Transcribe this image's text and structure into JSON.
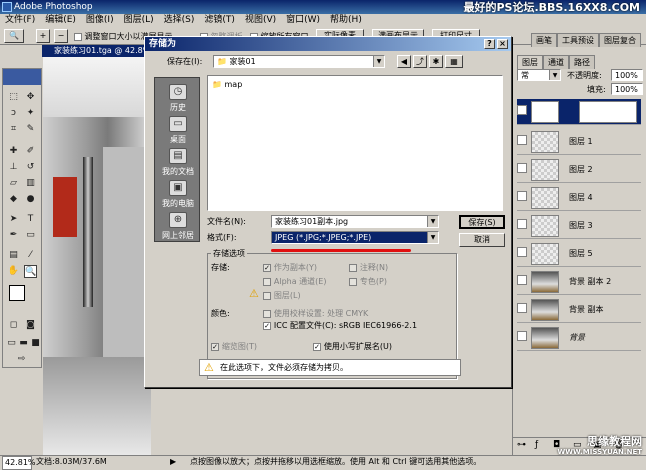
{
  "app": {
    "title": "Adobe Photoshop"
  },
  "watermark_top": "最好的PS论坛.BBS.16XX8.COM",
  "watermark_bottom": [
    "思缘教程网",
    "WWW.MISSYUAN.NET"
  ],
  "menu": [
    "文件(F)",
    "编辑(E)",
    "图像(I)",
    "图层(L)",
    "选择(S)",
    "滤镜(T)",
    "视图(V)",
    "窗口(W)",
    "帮助(H)"
  ],
  "options": {
    "resize_window": "调整窗口大小以满屏显示",
    "ignore_palettes": "忽略调板",
    "zoom_all": "缩放所有窗口",
    "actual_pixels": "实际像素",
    "fit_screen": "满画布显示",
    "print_size": "打印尺寸"
  },
  "canvas": {
    "title": "家装练习01.tga @ 42.8%"
  },
  "right_panel": {
    "tabs_top": [
      "画笔",
      "工具预设",
      "图层复合"
    ],
    "tabs_layers": [
      "图层",
      "通道",
      "路径"
    ],
    "blend_mode": "常",
    "opacity_label": "不透明度:",
    "opacity_value": "100%",
    "fill_label": "填充:",
    "fill_value": "100%",
    "layers": [
      "图层 1",
      "图层 2",
      "图层 4",
      "图层 3",
      "图层 5",
      "背景 副本 2",
      "背景 副本",
      "背景"
    ]
  },
  "status": {
    "zoom": "42.81%",
    "doc": "文档:8.03M/37.6M",
    "hint": "点按图像以放大；点按并拖移以用选框缩放。使用 Alt 和 Ctrl 键可选用其他选项。"
  },
  "dialog": {
    "title": "存储为",
    "save_in_label": "保存在(I):",
    "save_in_value": "家装01",
    "places": [
      "历史",
      "桌面",
      "我的文档",
      "我的电脑",
      "网上邻居"
    ],
    "files": [
      "map"
    ],
    "filename_label": "文件名(N):",
    "filename_value": "家装练习01副本.jpg",
    "format_label": "格式(F):",
    "format_value": "JPEG (*.JPG;*.JPEG;*.JPE)",
    "save_button": "保存(S)",
    "cancel_button": "取消",
    "options_title": "存储选项",
    "store_label": "存储:",
    "as_copy": "作为副本(Y)",
    "annotations": "注释(N)",
    "alpha": "Alpha 通道(E)",
    "spot": "专色(P)",
    "layers": "图层(L)",
    "color_label": "颜色:",
    "use_proof": "使用校样设置: 处理 CMYK",
    "icc": "ICC 配置文件(C): sRGB IEC61966-2.1",
    "thumbnail": "缩览图(T)",
    "lowercase": "使用小写扩展名(U)",
    "warning": "在此选项下，文件必须存储为拷贝。"
  }
}
